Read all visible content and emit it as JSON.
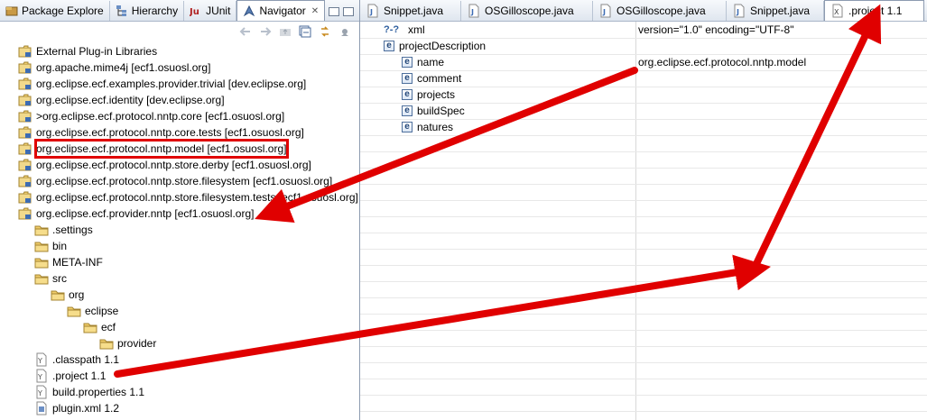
{
  "left_panel": {
    "tabs": [
      {
        "label": "Package Explore",
        "icon": "package-icon"
      },
      {
        "label": "Hierarchy",
        "icon": "hierarchy-icon"
      },
      {
        "label": "JUnit",
        "icon": "junit-icon"
      },
      {
        "label": "Navigator",
        "icon": "navigator-icon",
        "close": "✕"
      }
    ],
    "tree": [
      {
        "label": "External Plug-in Libraries",
        "icon": "project-icon"
      },
      {
        "label": "org.apache.mime4j  [ecf1.osuosl.org]",
        "icon": "project-icon"
      },
      {
        "label": "org.eclipse.ecf.examples.provider.trivial  [dev.eclipse.org]",
        "icon": "project-icon"
      },
      {
        "label": "org.eclipse.ecf.identity  [dev.eclipse.org]",
        "icon": "project-icon"
      },
      {
        "label": ">org.eclipse.ecf.protocol.nntp.core  [ecf1.osuosl.org]",
        "icon": "project-icon"
      },
      {
        "label": "org.eclipse.ecf.protocol.nntp.core.tests  [ecf1.osuosl.org]",
        "icon": "project-icon"
      },
      {
        "label": "org.eclipse.ecf.protocol.nntp.model  [ecf1.osuosl.org]",
        "icon": "project-icon",
        "highlight": true
      },
      {
        "label": "org.eclipse.ecf.protocol.nntp.store.derby  [ecf1.osuosl.org]",
        "icon": "project-icon"
      },
      {
        "label": "org.eclipse.ecf.protocol.nntp.store.filesystem  [ecf1.osuosl.org]",
        "icon": "project-icon"
      },
      {
        "label": "org.eclipse.ecf.protocol.nntp.store.filesystem.tests  [ecf1.osuosl.org]",
        "icon": "project-icon"
      },
      {
        "label": "org.eclipse.ecf.provider.nntp  [ecf1.osuosl.org]",
        "icon": "project-icon"
      },
      {
        "label": ".settings",
        "icon": "folder-icon"
      },
      {
        "label": "bin",
        "icon": "folder-icon"
      },
      {
        "label": "META-INF",
        "icon": "folder-icon"
      },
      {
        "label": "src",
        "icon": "folder-icon"
      },
      {
        "label": "org",
        "icon": "folder-icon"
      },
      {
        "label": "eclipse",
        "icon": "folder-icon"
      },
      {
        "label": "ecf",
        "icon": "folder-icon"
      },
      {
        "label": "provider",
        "icon": "folder-icon"
      },
      {
        "label": ".classpath  1.1",
        "icon": "file-icon"
      },
      {
        "label": ".project  1.1",
        "icon": "file-icon"
      },
      {
        "label": "build.properties  1.1",
        "icon": "file-icon"
      },
      {
        "label": "plugin.xml  1.2",
        "icon": "plugin-file-icon"
      }
    ]
  },
  "editor": {
    "tabs": [
      {
        "label": "Snippet.java",
        "icon": "java-file-icon"
      },
      {
        "label": "OSGilloscope.java",
        "icon": "java-file-icon"
      },
      {
        "label": "OSGilloscope.java",
        "icon": "java-file-icon"
      },
      {
        "label": "Snippet.java",
        "icon": "java-file-icon"
      },
      {
        "label": ".project 1.1",
        "icon": "xml-file-icon",
        "active": true
      }
    ],
    "xml_rows": [
      {
        "icon_text": "?-?",
        "name": "xml",
        "value": "version=\"1.0\" encoding=\"UTF-8\""
      },
      {
        "icon_text": "e",
        "name": "projectDescription",
        "value": ""
      },
      {
        "icon_text": "e",
        "name": "name",
        "value": "org.eclipse.ecf.protocol.nntp.model"
      },
      {
        "icon_text": "e",
        "name": "comment",
        "value": ""
      },
      {
        "icon_text": "e",
        "name": "projects",
        "value": ""
      },
      {
        "icon_text": "e",
        "name": "buildSpec",
        "value": ""
      },
      {
        "icon_text": "e",
        "name": "natures",
        "value": ""
      }
    ]
  },
  "colors": {
    "annotation": "#e00000",
    "folder": "#e8c25a",
    "tab_bar": "#dfe6ef"
  }
}
